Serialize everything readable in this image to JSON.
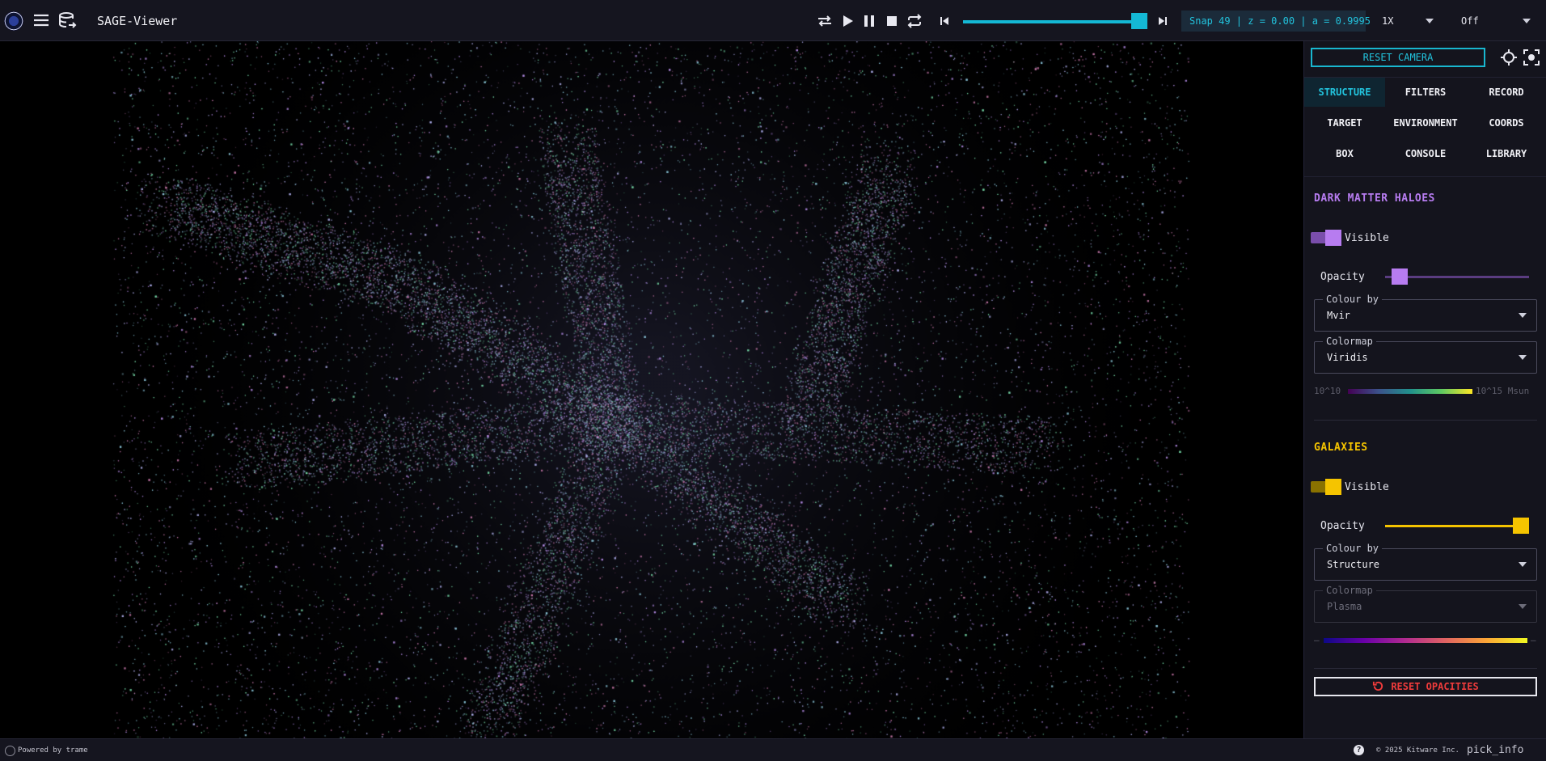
{
  "app": {
    "title": "SAGE-Viewer"
  },
  "timeline": {
    "progress_fraction": 1.0,
    "snap_readout": "Snap 49 | z = 0.00 | a = 0.9995",
    "speed": "1X",
    "loop_mode": "Off"
  },
  "panel": {
    "reset_camera_label": "RESET CAMERA",
    "tabs": [
      "STRUCTURE",
      "FILTERS",
      "RECORD",
      "TARGET",
      "ENVIRONMENT",
      "COORDS",
      "BOX",
      "CONSOLE",
      "LIBRARY"
    ],
    "active_tab": "STRUCTURE",
    "haloes": {
      "title": "DARK MATTER HALOES",
      "accent": "#b77cf0",
      "visible_label": "Visible",
      "opacity_label": "Opacity",
      "opacity_fraction": 0.05,
      "colour_by_legend": "Colour by",
      "colour_by_value": "Mvir",
      "colormap_legend": "Colormap",
      "colormap_value": "Viridis",
      "cbar_min": "10^10",
      "cbar_max": "10^15 Msun"
    },
    "galaxies": {
      "title": "GALAXIES",
      "accent": "#f5c400",
      "visible_label": "Visible",
      "opacity_label": "Opacity",
      "opacity_fraction": 1.0,
      "colour_by_legend": "Colour by",
      "colour_by_value": "Structure",
      "colormap_legend": "Colormap",
      "colormap_value": "Plasma",
      "cbar_min": "–",
      "cbar_max": "–"
    },
    "reset_opacities_label": "RESET OPACITIES"
  },
  "footer": {
    "powered_by": "Powered by trame",
    "copyright": "© 2025 Kitware Inc.",
    "pick_info": "pick_info"
  },
  "colors": {
    "accent_cyan": "#22c3dd",
    "danger_red": "#ef3b3b"
  }
}
